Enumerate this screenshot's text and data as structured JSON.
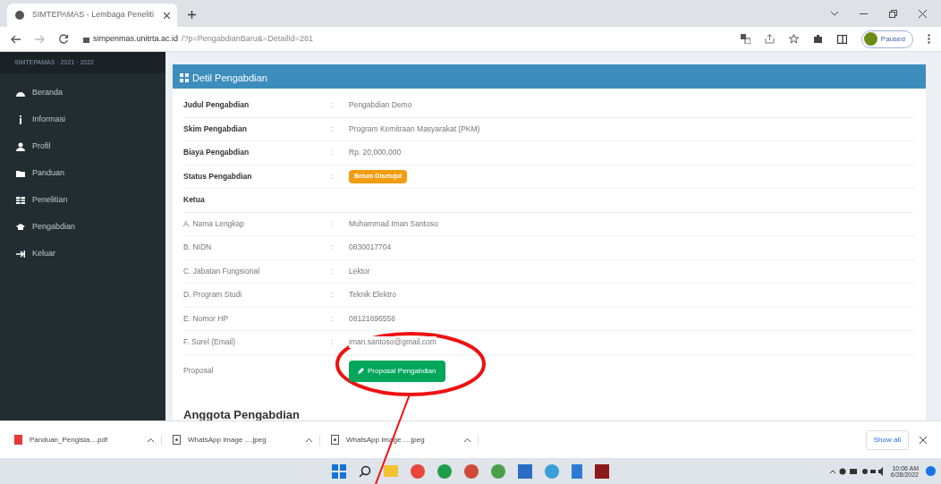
{
  "browser": {
    "tab_title": "SIMTEPAMAS - Lembaga Peneliti",
    "url_host": "simpenmas.unitrta.ac.id",
    "url_path": "/?p=PengabdianBaru&=DetailId=281",
    "profile_label": "Paused"
  },
  "sidebar": {
    "brand": "SIMTEPAMAS · 2021 · 2022",
    "items": [
      {
        "label": "Beranda"
      },
      {
        "label": "Informasi"
      },
      {
        "label": "Profil"
      },
      {
        "label": "Panduan"
      },
      {
        "label": "Penelitian"
      },
      {
        "label": "Pengabdian"
      },
      {
        "label": "Keluar"
      }
    ]
  },
  "card": {
    "title": "Detil Pengabdian",
    "rows": [
      {
        "kind": "field",
        "label": "Judul Pengabdian",
        "bold": true,
        "colon": ":",
        "value": "Pengabdian Demo"
      },
      {
        "kind": "field",
        "label": "Skim Pengabdian",
        "bold": true,
        "colon": ":",
        "value": "Program Kemitraan Masyarakat (PKM)"
      },
      {
        "kind": "field",
        "label": "Biaya Pengabdian",
        "bold": true,
        "colon": ":",
        "value": "Rp. 20,000,000"
      },
      {
        "kind": "badge",
        "label": "Status Pengabdian",
        "bold": true,
        "colon": ":",
        "value": "Belum Disetujui"
      },
      {
        "kind": "heading",
        "label": "Ketua",
        "bold": true
      },
      {
        "kind": "field",
        "label": "A. Nama Lengkap",
        "bold": false,
        "colon": ":",
        "value": "Muhammad Iman Santoso"
      },
      {
        "kind": "field",
        "label": "B. NIDN",
        "bold": false,
        "colon": ":",
        "value": "0830017704"
      },
      {
        "kind": "field",
        "label": "C. Jabatan Fungsional",
        "bold": false,
        "colon": ":",
        "value": "Lektor"
      },
      {
        "kind": "field",
        "label": "D. Program Studi",
        "bold": false,
        "colon": ":",
        "value": "Teknik Elektro"
      },
      {
        "kind": "field",
        "label": "E. Nomor HP",
        "bold": false,
        "colon": ":",
        "value": "08121696556"
      },
      {
        "kind": "field",
        "label": "F. Surel (Email)",
        "bold": false,
        "colon": ":",
        "value": "iman.santoso@gmail.com"
      },
      {
        "kind": "button",
        "label": "Proposal",
        "bold": false,
        "value": "Proposal Pengabdian"
      }
    ],
    "section_title": "Anggota Pengabdian"
  },
  "downloads": {
    "items": [
      {
        "name": "Panduan_Pengisia....pdf",
        "kind": "pdf"
      },
      {
        "name": "WhatsApp Image ....jpeg",
        "kind": "image"
      },
      {
        "name": "WhatsApp Image ....jpeg",
        "kind": "image"
      }
    ],
    "show_all": "Show all"
  },
  "taskbar": {
    "time": "10:06 AM",
    "date": "6/28/2022"
  }
}
